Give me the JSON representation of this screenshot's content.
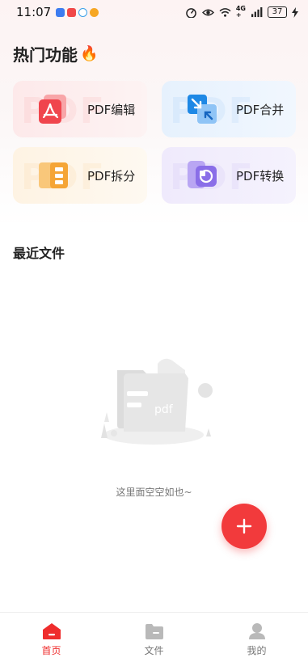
{
  "status_bar": {
    "time": "11:07",
    "lte_top": "4G",
    "lte_bottom": "+",
    "battery": "37"
  },
  "hot_section": {
    "title": "热门功能",
    "fire_emoji": "🔥"
  },
  "feature_cards": [
    {
      "label": "PDF编辑",
      "icon": "pdf-edit-icon",
      "color": "#f0454d"
    },
    {
      "label": "PDF合并",
      "icon": "pdf-merge-icon",
      "color": "#2f8ef0"
    },
    {
      "label": "PDF拆分",
      "icon": "pdf-split-icon",
      "color": "#f5a536"
    },
    {
      "label": "PDF转换",
      "icon": "pdf-convert-icon",
      "color": "#8a6ee8"
    }
  ],
  "watermark_text": "PDF",
  "recent_section": {
    "title": "最近文件",
    "empty_text": "这里面空空如也~",
    "illustration_label": "pdf"
  },
  "fab": {
    "icon": "plus-icon",
    "color": "#f23a3c"
  },
  "bottom_nav": [
    {
      "label": "首页",
      "icon": "home-icon",
      "active": true
    },
    {
      "label": "文件",
      "icon": "folder-icon",
      "active": false
    },
    {
      "label": "我的",
      "icon": "user-icon",
      "active": false
    }
  ],
  "colors": {
    "accent": "#ef2d2d"
  }
}
